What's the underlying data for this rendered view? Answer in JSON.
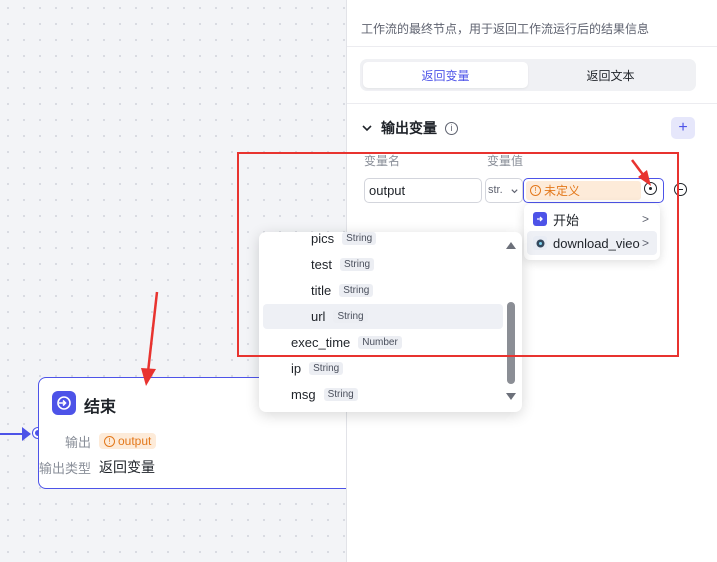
{
  "canvas": {
    "node": {
      "title": "结束",
      "output_label": "输出",
      "output_value": "output",
      "output_type_label": "输出类型",
      "output_type_value": "返回变量"
    }
  },
  "panel": {
    "description": "工作流的最终节点，用于返回工作流运行后的结果信息",
    "tabs": [
      "返回变量",
      "返回文本"
    ],
    "active_tab": "返回变量",
    "section_title": "输出变量",
    "col_name": "变量名",
    "col_value": "变量值",
    "row": {
      "name": "output",
      "type": "str.",
      "value": "未定义"
    }
  },
  "node_menu": {
    "items": [
      {
        "label": "开始",
        "icon": "start-node-icon"
      },
      {
        "label": "download_vieo",
        "icon": "plugin-node-icon"
      }
    ]
  },
  "variable_menu": {
    "items": [
      {
        "name": "pics",
        "type": "String"
      },
      {
        "name": "test",
        "type": "String"
      },
      {
        "name": "title",
        "type": "String"
      },
      {
        "name": "url",
        "type": "String"
      },
      {
        "name": "exec_time",
        "type": "Number"
      },
      {
        "name": "ip",
        "type": "String"
      },
      {
        "name": "msg",
        "type": "String"
      }
    ]
  },
  "colors": {
    "accent": "#4d53e8",
    "warning": "#e3781b",
    "warning_bg": "#fdebd9",
    "annotation": "#e8332f"
  }
}
